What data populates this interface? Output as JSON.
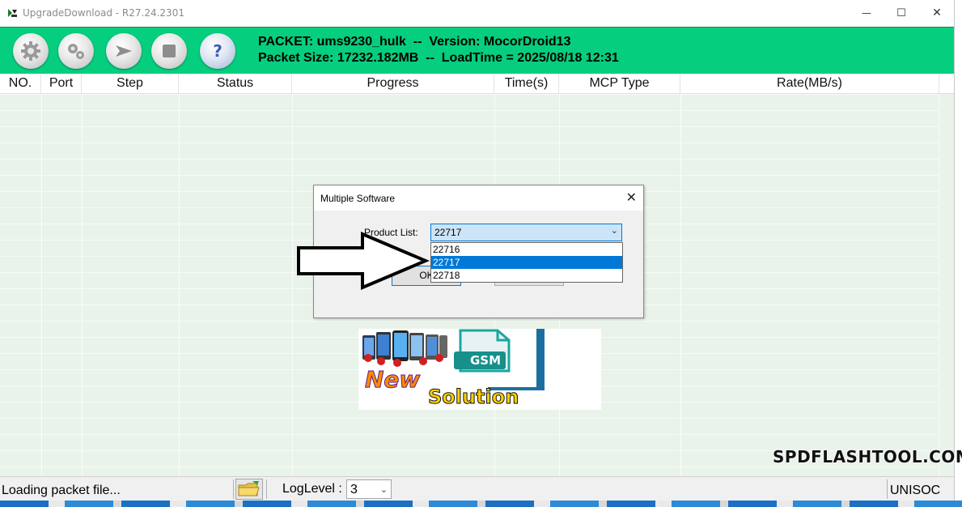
{
  "window": {
    "title": "UpgradeDownload - R27.24.2301",
    "minimize_glyph": "—",
    "maximize_glyph": "☐",
    "close_glyph": "✕"
  },
  "toolbar": {
    "buttons": [
      {
        "name": "load-packet-button",
        "icon": "gear-icon"
      },
      {
        "name": "settings-button",
        "icon": "gears-icon"
      },
      {
        "name": "start-button",
        "icon": "play-arrow-icon"
      },
      {
        "name": "stop-button",
        "icon": "stop-icon"
      },
      {
        "name": "help-button",
        "icon": "question-icon"
      }
    ],
    "packet_line": "PACKET: ums9230_hulk  --  Version: MocorDroid13",
    "size_line": "Packet Size: 17232.182MB  --  LoadTime = 2025/08/18 12:31",
    "background_color": "#05cf7e"
  },
  "table": {
    "columns": [
      "NO.",
      "Port",
      "Step",
      "Status",
      "Progress",
      "Time(s)",
      "MCP Type",
      "Rate(MB/s)"
    ]
  },
  "dialog": {
    "title": "Multiple Software",
    "close_glyph": "✕",
    "product_label": "Product List:",
    "selected": "22717",
    "options": [
      "22716",
      "22717",
      "22718"
    ],
    "ok_label": "OK",
    "cancel_label": ""
  },
  "logo": {
    "line1": "New",
    "line2": "Solution",
    "badge": "GSM"
  },
  "watermark": "SPDFLASHTOOL.COM",
  "statusbar": {
    "status_text": "Loading packet file...",
    "loglevel_label": "LogLevel :",
    "loglevel_value": "3",
    "chip": "UNISOC"
  },
  "colors": {
    "accent": "#05cf7e",
    "selection": "#0078d7",
    "grid_bg": "#e9f3ea"
  }
}
